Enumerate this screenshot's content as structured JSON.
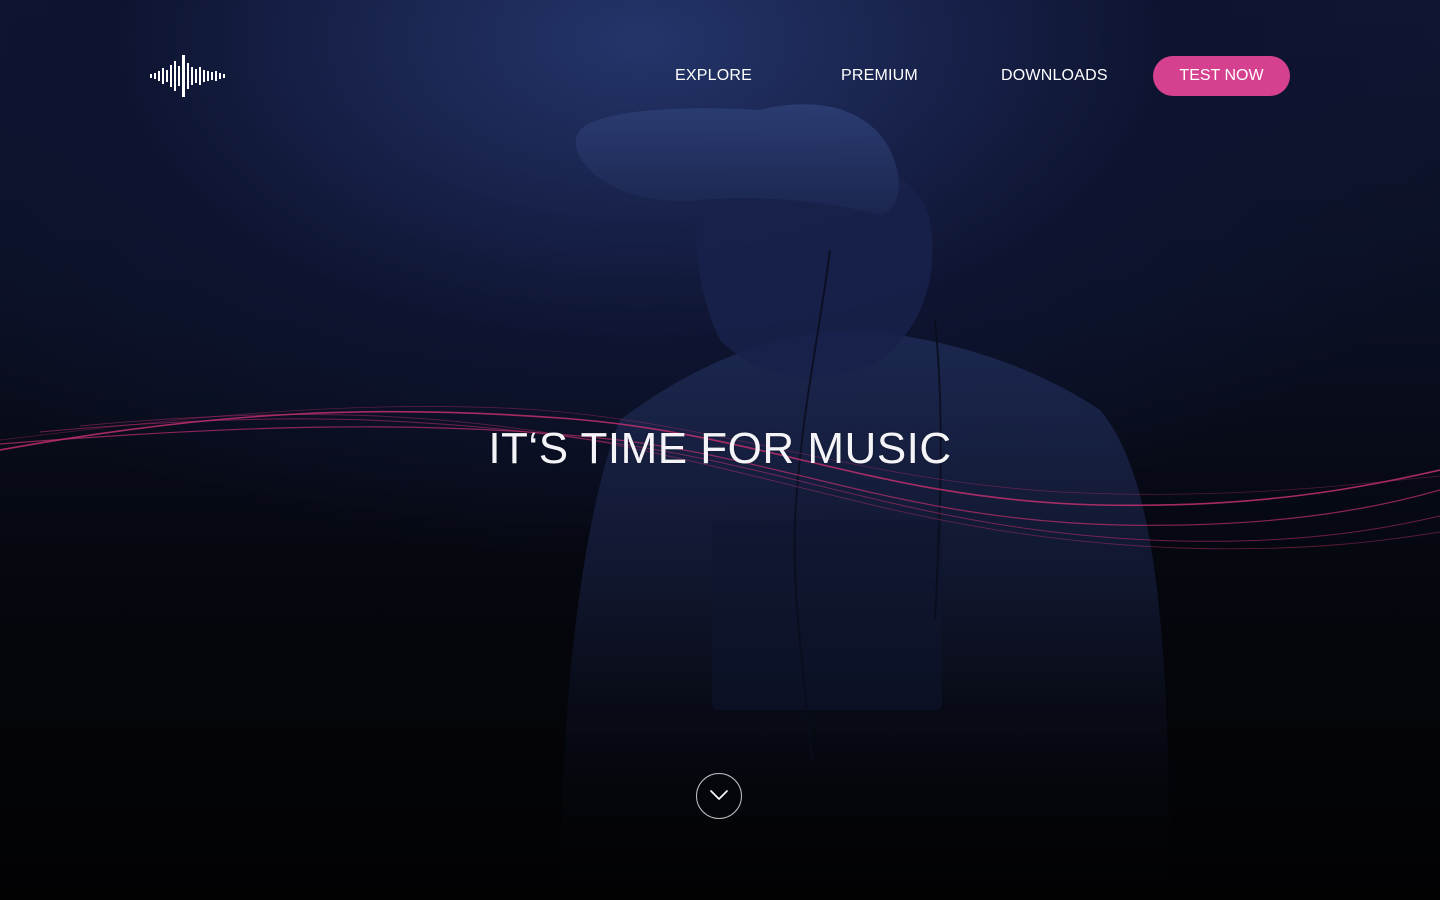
{
  "brand": {
    "logo_icon": "soundwave-logo-icon"
  },
  "nav": {
    "items": [
      {
        "label": "EXPLORE"
      },
      {
        "label": "PREMIUM"
      },
      {
        "label": "DOWNLOADS"
      }
    ],
    "cta_label": "TEST NOW"
  },
  "hero": {
    "headline": "IT‘S TIME FOR MUSIC",
    "scroll_icon": "chevron-down-icon"
  },
  "colors": {
    "accent": "#d6418f",
    "background_top": "#24356a",
    "background_bottom": "#020203",
    "wave": "#c2306f"
  }
}
